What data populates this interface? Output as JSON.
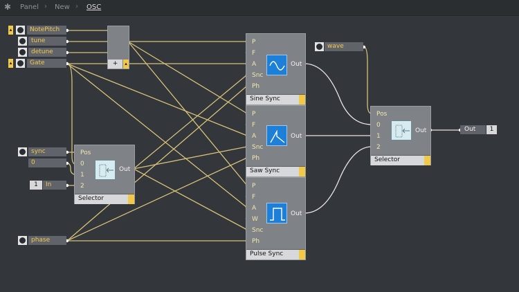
{
  "breadcrumb": {
    "items": [
      "Panel",
      "New",
      "OSC"
    ]
  },
  "controls": [
    {
      "label": "NotePitch"
    },
    {
      "label": "tune"
    },
    {
      "label": "detune"
    },
    {
      "label": "Gate"
    }
  ],
  "adder": {
    "label": "+"
  },
  "selector_small": {
    "title": "Selector",
    "inputs": [
      "Pos",
      "0",
      "1",
      "2"
    ],
    "output": "Out",
    "sync_label": "sync",
    "const_value": "0",
    "in_number": "1",
    "in_label": "In"
  },
  "phase": {
    "label": "phase"
  },
  "oscillators": [
    {
      "title": "Sine Sync",
      "inputs": [
        "P",
        "F",
        "A",
        "Snc",
        "Ph"
      ],
      "output": "Out"
    },
    {
      "title": "Saw Sync",
      "inputs": [
        "P",
        "F",
        "A",
        "Snc",
        "Ph"
      ],
      "output": "Out"
    },
    {
      "title": "Pulse Sync",
      "inputs": [
        "P",
        "F",
        "A",
        "W",
        "Snc",
        "Ph"
      ],
      "output": "Out"
    }
  ],
  "wave": {
    "label": "wave"
  },
  "selector_main": {
    "title": "Selector",
    "inputs": [
      "Pos",
      "0",
      "1",
      "2"
    ],
    "output": "Out"
  },
  "output_module": {
    "label": "Out",
    "number": "1"
  },
  "colors": {
    "background": "#33363a",
    "wire": "#d8c27a",
    "wire_audio": "#e6e6e6",
    "accent": "#f2c84b",
    "display": "#1d7fd8"
  }
}
